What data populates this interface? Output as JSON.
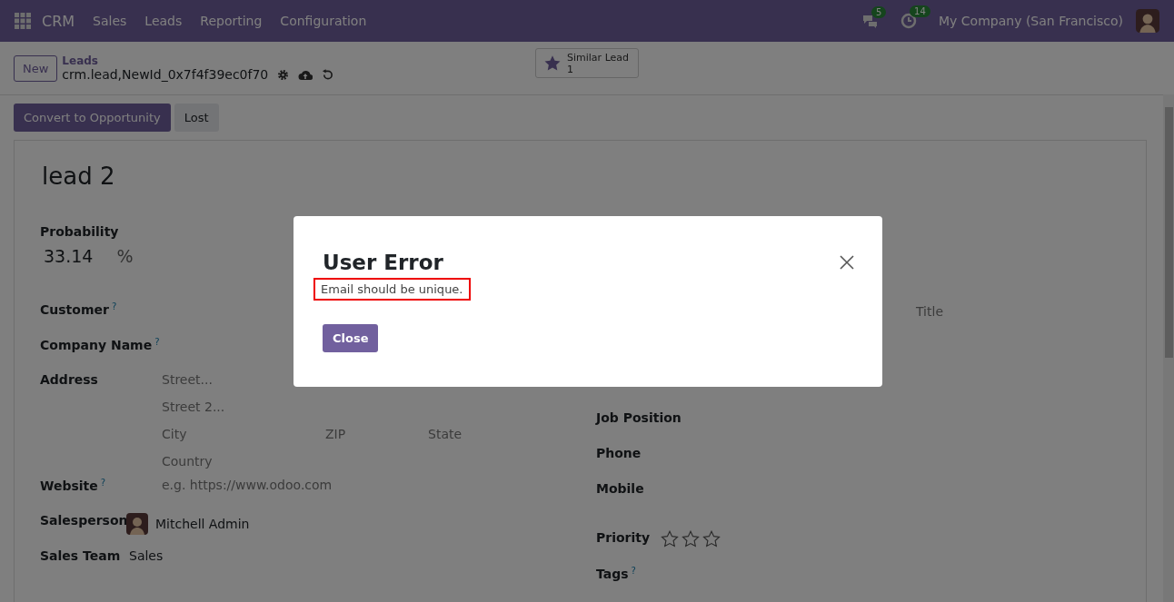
{
  "navbar": {
    "app_name": "CRM",
    "menu": [
      "Sales",
      "Leads",
      "Reporting",
      "Configuration"
    ],
    "messages_count": "5",
    "activities_count": "14",
    "company": "My Company (San Francisco)"
  },
  "control_panel": {
    "new_button": "New",
    "breadcrumb": "Leads",
    "record": "crm.lead,NewId_0x7f4f39ec0f70",
    "smart_button": {
      "label": "Similar Lead",
      "count": "1"
    }
  },
  "status_buttons": [
    {
      "label": "Convert to Opportunity",
      "kind": "primary"
    },
    {
      "label": "Lost",
      "kind": "secondary"
    }
  ],
  "form": {
    "title": "lead 2",
    "probability": {
      "label": "Probability",
      "value": "33.14",
      "unit": "%"
    },
    "left_fields": [
      {
        "kind": "empty",
        "label": "Customer",
        "help": "?"
      },
      {
        "kind": "empty",
        "label": "Company Name",
        "help": "?"
      },
      {
        "kind": "address",
        "label": "Address",
        "street": "Street...",
        "street2": "Street 2...",
        "city": "City",
        "zip": "ZIP",
        "state": "State",
        "country": "Country"
      },
      {
        "kind": "text",
        "label": "Website",
        "help": "?",
        "placeholder": "e.g. https://www.odoo.com"
      },
      {
        "kind": "user",
        "label": "Salesperson",
        "value": "Mitchell Admin"
      },
      {
        "kind": "text",
        "label": "Sales Team",
        "value": "Sales"
      }
    ],
    "right_fields": [
      {
        "kind": "title",
        "placeholder": "Title"
      },
      {
        "kind": "hidden"
      },
      {
        "kind": "hidden"
      },
      {
        "kind": "empty",
        "label": "Job Position"
      },
      {
        "kind": "empty",
        "label": "Phone"
      },
      {
        "kind": "empty",
        "label": "Mobile"
      },
      {
        "kind": "priority",
        "label": "Priority",
        "stars": 0
      },
      {
        "kind": "empty",
        "label": "Tags",
        "help": "?"
      }
    ]
  },
  "dialog": {
    "title": "User Error",
    "message": "Email should be unique.",
    "highlighted": true,
    "close_button": "Close"
  }
}
